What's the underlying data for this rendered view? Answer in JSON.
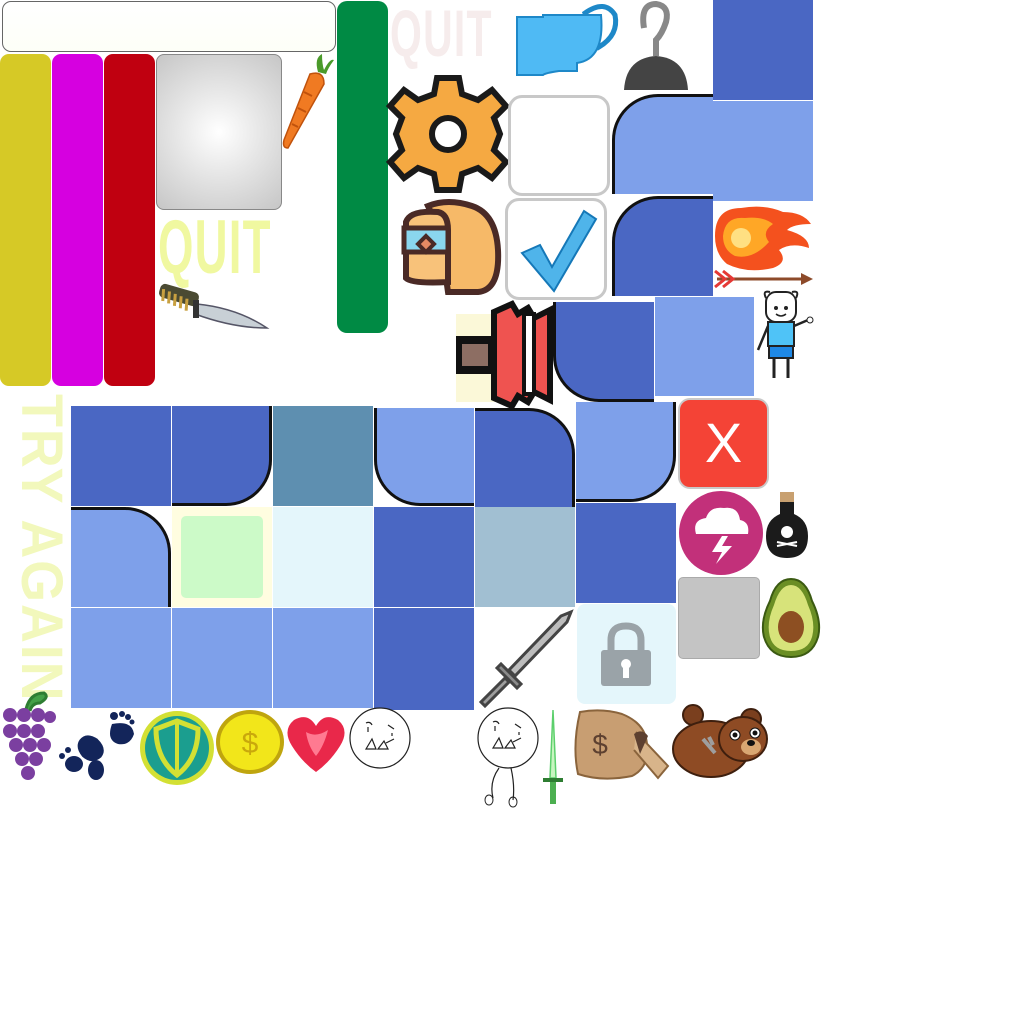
{
  "ui": {
    "quit_label": "QUIT",
    "try_again_label": "TRY AGAIN",
    "close_label": "X"
  },
  "colors": {
    "bar_yellow": "#d6c926",
    "bar_magenta": "#d600e0",
    "bar_red": "#c00010",
    "bar_green": "#008a44",
    "tile_dark": "#4a67c3",
    "tile_light": "#7ea0ea",
    "tile_steel": "#5e8fb0",
    "tile_mist": "#a1bfd2",
    "tile_ice": "#e4f6fb",
    "tile_mint": "#ccfac8",
    "close_red": "#f44336",
    "quit_light": "#f0f8a0"
  },
  "icons": [
    "trophy-icon",
    "hook-icon",
    "gear-icon",
    "backpack-icon",
    "checkmark-icon",
    "carrot-icon",
    "knife-icon",
    "fireball-icon",
    "arrow-icon",
    "finn-character",
    "crown-banner-icon",
    "storm-cloud-icon",
    "poison-bottle-icon",
    "avocado-icon",
    "lock-icon",
    "sword-icon",
    "grapes-icon",
    "footprints-icon",
    "shield-coin-icon",
    "gold-coin-icon",
    "heart-icon",
    "doodle-face-icon",
    "doodle-figure-icon",
    "glowing-sword-icon",
    "money-bag-icon",
    "bear-icon"
  ]
}
